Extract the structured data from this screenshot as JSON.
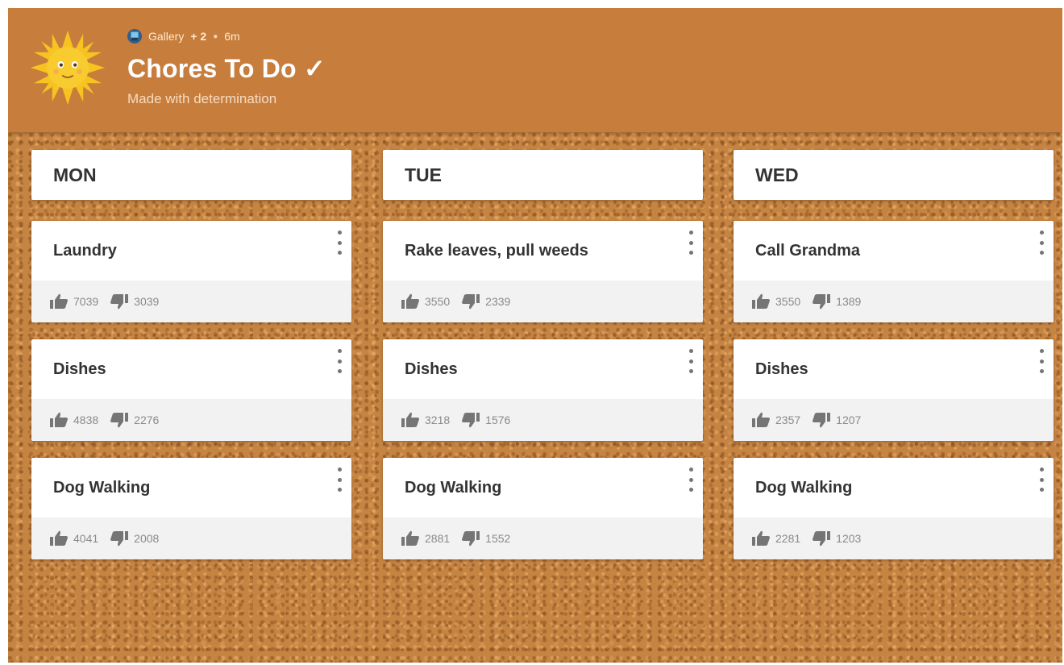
{
  "header": {
    "author": "Gallery",
    "contributors": "+ 2",
    "time": "6m",
    "title": "Chores To Do ✓",
    "subtitle": "Made with determination",
    "icon": "sun-face-icon"
  },
  "columns": [
    {
      "day": "MON",
      "cards": [
        {
          "title": "Laundry",
          "up": "7039",
          "down": "3039"
        },
        {
          "title": "Dishes",
          "up": "4838",
          "down": "2276"
        },
        {
          "title": "Dog Walking",
          "up": "4041",
          "down": "2008"
        }
      ]
    },
    {
      "day": "TUE",
      "cards": [
        {
          "title": "Rake leaves, pull weeds",
          "up": "3550",
          "down": "2339"
        },
        {
          "title": "Dishes",
          "up": "3218",
          "down": "1576"
        },
        {
          "title": "Dog Walking",
          "up": "2881",
          "down": "1552"
        }
      ]
    },
    {
      "day": "WED",
      "cards": [
        {
          "title": "Call Grandma",
          "up": "3550",
          "down": "1389"
        },
        {
          "title": "Dishes",
          "up": "2357",
          "down": "1207"
        },
        {
          "title": "Dog Walking",
          "up": "2281",
          "down": "1203"
        }
      ]
    }
  ],
  "colors": {
    "header_bg": "#c77d3c",
    "board_bg": "#c68442",
    "card_bg": "#ffffff",
    "footer_bg": "#f2f2f2"
  }
}
